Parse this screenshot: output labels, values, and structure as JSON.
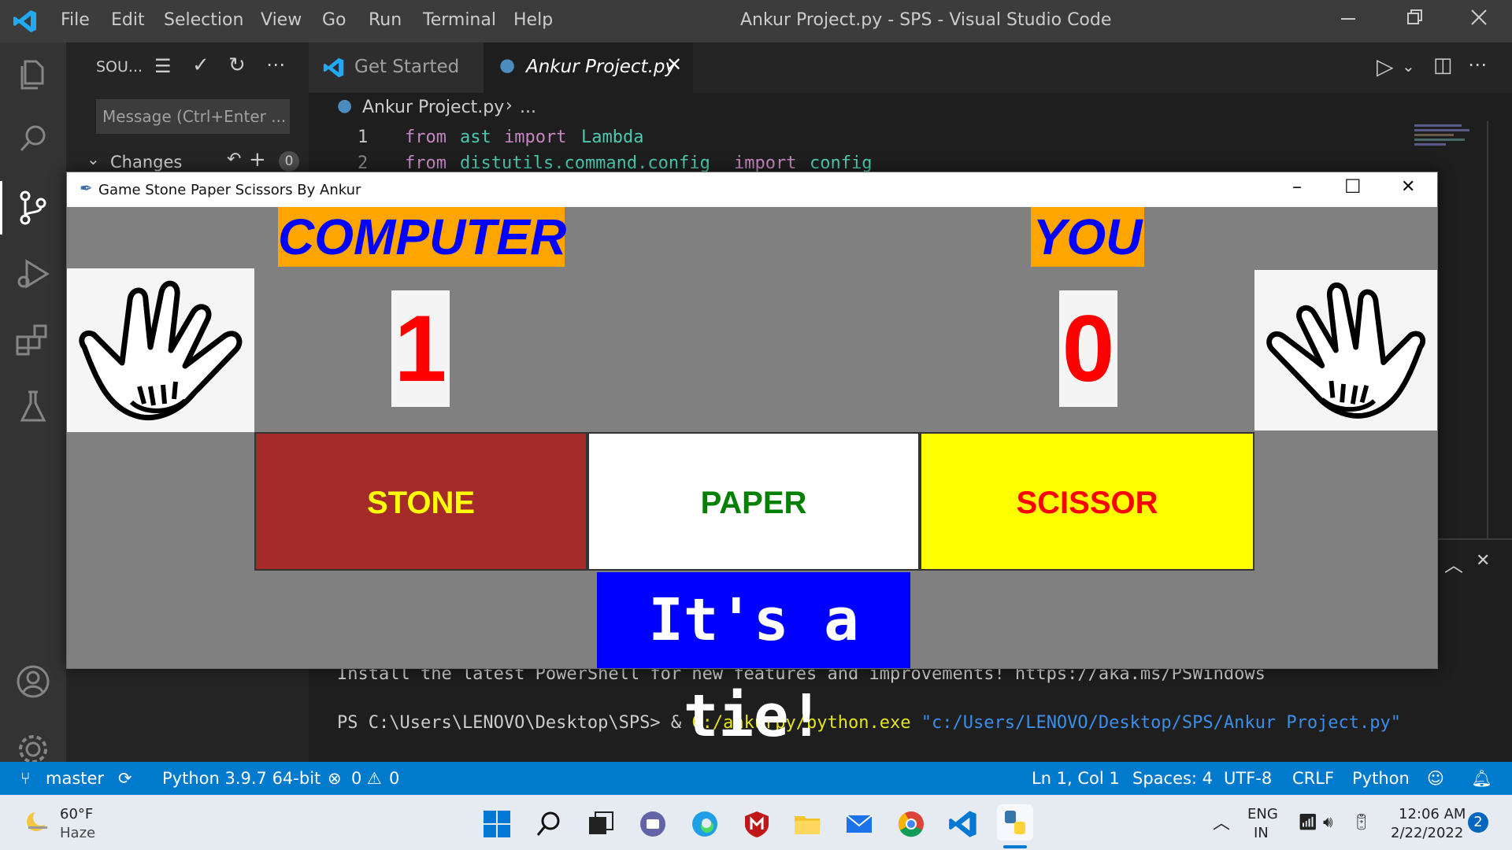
{
  "vscode": {
    "menu": [
      "File",
      "Edit",
      "Selection",
      "View",
      "Go",
      "Run",
      "Terminal",
      "Help"
    ],
    "window_title": "Ankur Project.py - SPS - Visual Studio Code",
    "sidebar": {
      "header": "SOU...",
      "message_placeholder": "Message (Ctrl+Enter ...",
      "changes_label": "Changes",
      "changes_count": "0"
    },
    "tabs": [
      {
        "label": "Get Started"
      },
      {
        "label": "Ankur Project.py"
      }
    ],
    "breadcrumb": {
      "file": "Ankur Project.py",
      "more": "..."
    },
    "code_lines": [
      {
        "num": "1",
        "kw1": "from",
        "mod": "ast",
        "kw2": "import",
        "name": "Lambda"
      },
      {
        "num": "2",
        "kw1": "from",
        "mod": "distutils.command.config",
        "kw2": "import",
        "name": "config"
      }
    ],
    "terminal": {
      "line1": "Install the latest PowerShell for new features and improvements! https://aka.ms/PSWindows",
      "prompt": "PS C:\\Users\\LENOVO\\Desktop\\SPS> & ",
      "exe": "C:/ankurpy/python.exe",
      "arg": "\"c:/Users/LENOVO/Desktop/SPS/Ankur Project.py\""
    },
    "status": {
      "branch": "master",
      "interpreter": "Python 3.9.7 64-bit",
      "errors": "0",
      "warnings": "0",
      "position": "Ln 1, Col 1",
      "spaces": "Spaces: 4",
      "encoding": "UTF-8",
      "eol": "CRLF",
      "language": "Python"
    }
  },
  "game": {
    "title": "Game Stone Paper Scissors By Ankur",
    "computer_label": "COMPUTER",
    "you_label": "YOU",
    "computer_score": "1",
    "you_score": "0",
    "buttons": {
      "stone": "STONE",
      "paper": "PAPER",
      "scissor": "SCISSOR"
    },
    "result": "It's a tie!"
  },
  "taskbar": {
    "weather_temp": "60°F",
    "weather_desc": "Haze",
    "lang1": "ENG",
    "lang2": "IN",
    "time": "12:06 AM",
    "date": "2/22/2022",
    "notifications": "2"
  },
  "colors": {
    "accent": "#007acc",
    "header_bg": "#ffa500",
    "header_text": "#0000ff",
    "stone_bg": "#a52a2a",
    "stone_text": "#ffff00",
    "paper_text": "#008000",
    "scissor_bg": "#ffff00",
    "scissor_text": "#ff0000",
    "result_bg": "#0000ff"
  }
}
